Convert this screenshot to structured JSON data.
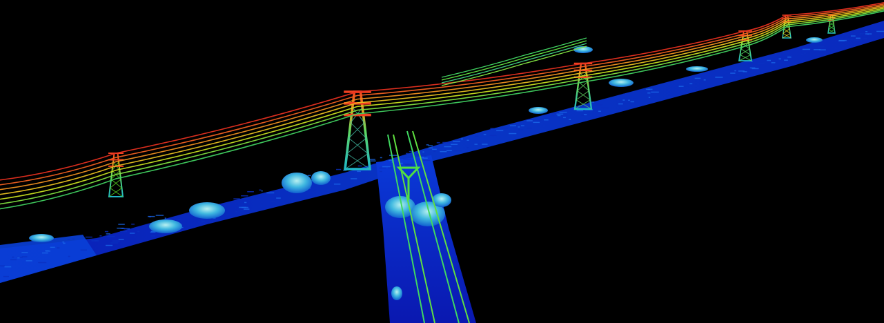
{
  "scene": {
    "background": "#000000",
    "elevation_colormap": [
      "#0a18b8",
      "#0050e0",
      "#00a8e8",
      "#00d8a0",
      "#60e040",
      "#e8e020",
      "#f08020",
      "#e82818"
    ],
    "towers": [
      {
        "id": "tower-1",
        "color": "#58d820"
      },
      {
        "id": "tower-2",
        "color": "#40b8a0"
      },
      {
        "id": "tower-3",
        "color": "#60d060"
      },
      {
        "id": "tower-4",
        "color": "#58e060"
      },
      {
        "id": "tower-5",
        "color": "#e8e020"
      },
      {
        "id": "tower-6",
        "color": "#40d040"
      }
    ],
    "cable_colors": [
      "#e83020",
      "#f06020",
      "#f09020",
      "#e8c020",
      "#c8e020",
      "#80e040",
      "#40d060"
    ]
  }
}
